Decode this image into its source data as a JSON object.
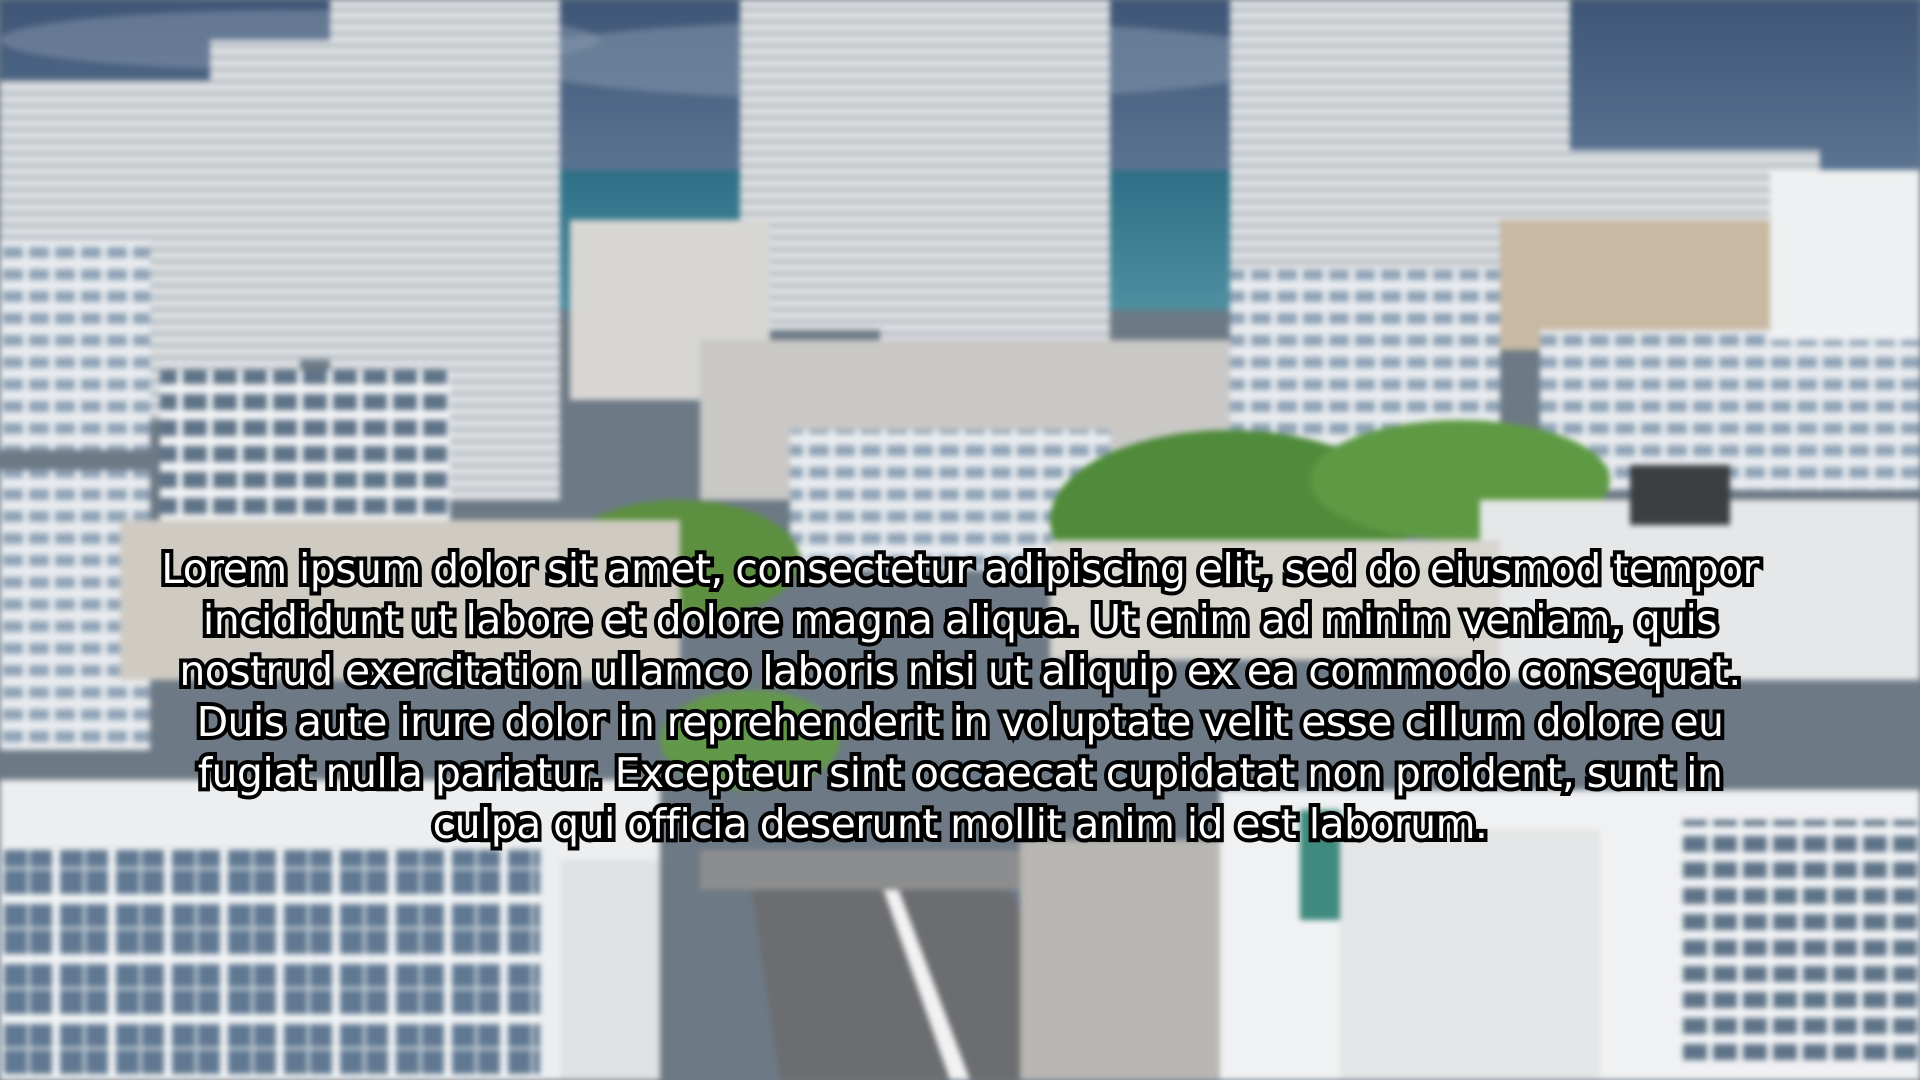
{
  "video": {
    "scene_description_icon": "city-skyline-background",
    "subtitle_lines": [
      "Lorem ipsum dolor sit amet, consectetur adipiscing elit, sed do eiusmod tempor",
      "incididunt ut labore et dolore magna aliqua. Ut enim ad minim veniam, quis",
      "nostrud exercitation ullamco laboris nisi ut aliquip ex ea commodo consequat.",
      "Duis aute irure dolor in reprehenderit in voluptate velit esse cillum dolore eu",
      "fugiat nulla pariatur. Excepteur sint occaecat cupidatat non proident, sunt in",
      "culpa qui officia deserunt mollit anim id est laborum."
    ],
    "colors": {
      "subtitle_fill": "#ffffff",
      "subtitle_outline": "#000000",
      "sky": "#4a5f7a"
    }
  }
}
